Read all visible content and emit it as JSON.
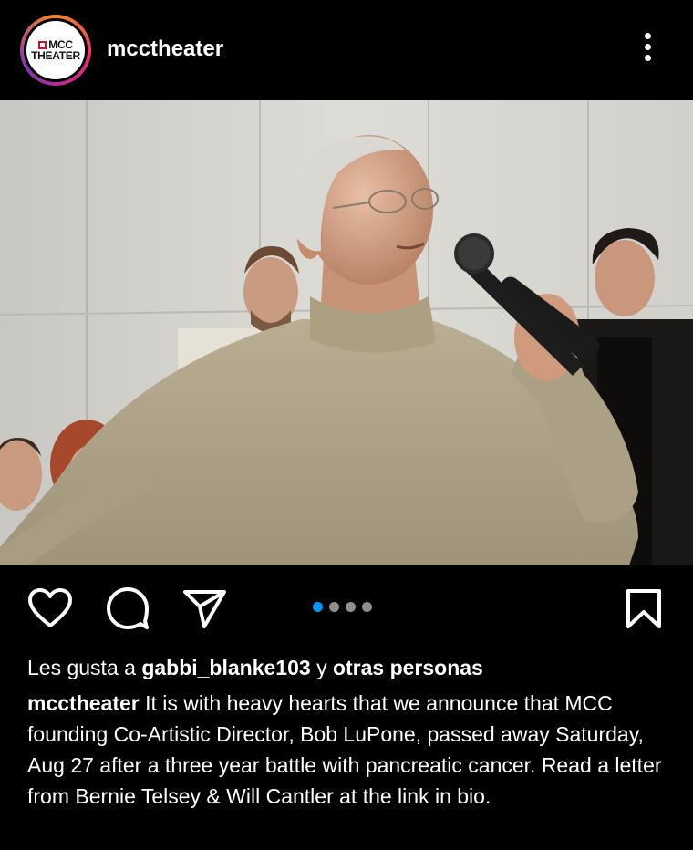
{
  "post": {
    "username": "mcctheater",
    "avatar_logo": {
      "line1": "MCC",
      "line2": "THEATER"
    },
    "carousel": {
      "count": 4,
      "active_index": 0
    },
    "likes": {
      "prefix": "Les gusta a",
      "user": "gabbi_blanke103",
      "conjunction": "y",
      "others": "otras personas"
    },
    "caption": {
      "username": "mcctheater",
      "text": "It is with heavy hearts that we announce that MCC founding Co-Artistic Director, Bob LuPone, passed away Saturday, Aug 27 after a three year battle with pancreatic cancer. Read a letter from Bernie Telsey & Will Cantler at the link in bio."
    }
  },
  "icons": {
    "more": "more-vertical-icon",
    "like": "heart-icon",
    "comment": "comment-icon",
    "share": "send-icon",
    "save": "bookmark-icon"
  },
  "colors": {
    "background": "#000000",
    "text": "#ffffff",
    "active_dot": "#0095f6",
    "inactive_dot": "#8e8e8e",
    "logo_red": "#c8102e"
  }
}
